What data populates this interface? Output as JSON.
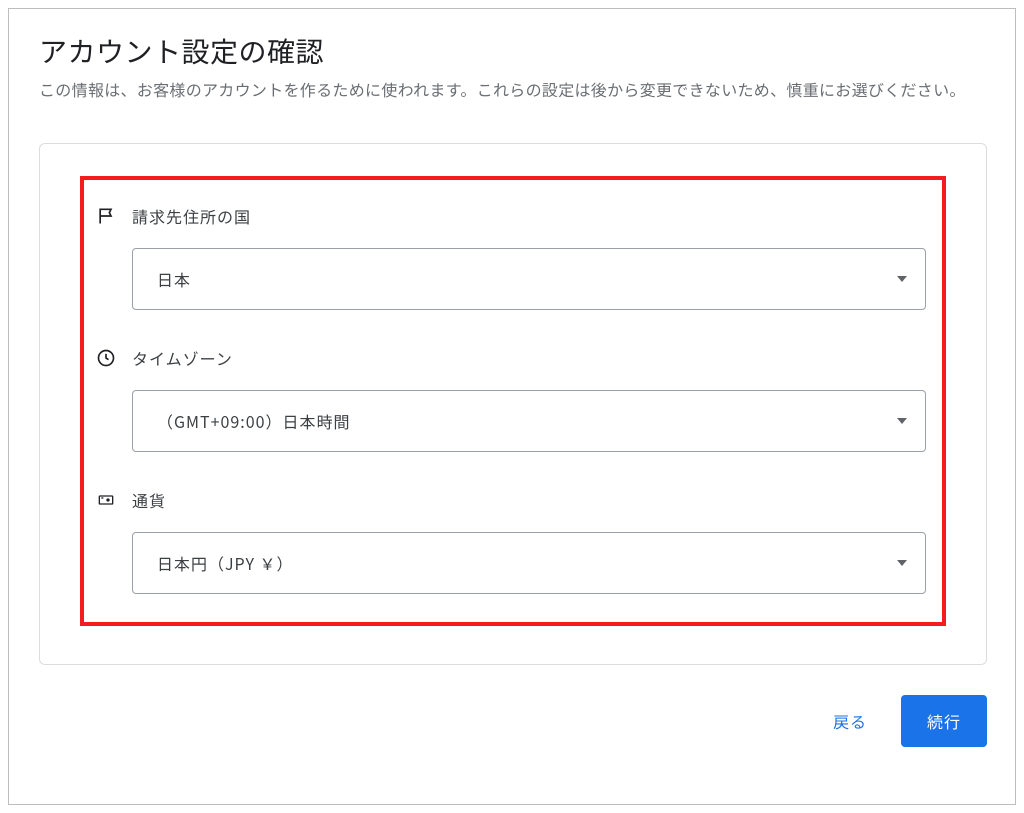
{
  "header": {
    "title": "アカウント設定の確認",
    "subtitle": "この情報は、お客様のアカウントを作るために使われます。これらの設定は後から変更できないため、慎重にお選びください。"
  },
  "fields": {
    "country": {
      "label": "請求先住所の国",
      "value": "日本"
    },
    "timezone": {
      "label": "タイムゾーン",
      "value": "（GMT+09:00）日本時間"
    },
    "currency": {
      "label": "通貨",
      "value": "日本円（JPY ￥）"
    }
  },
  "actions": {
    "back": "戻る",
    "continue": "続行"
  }
}
